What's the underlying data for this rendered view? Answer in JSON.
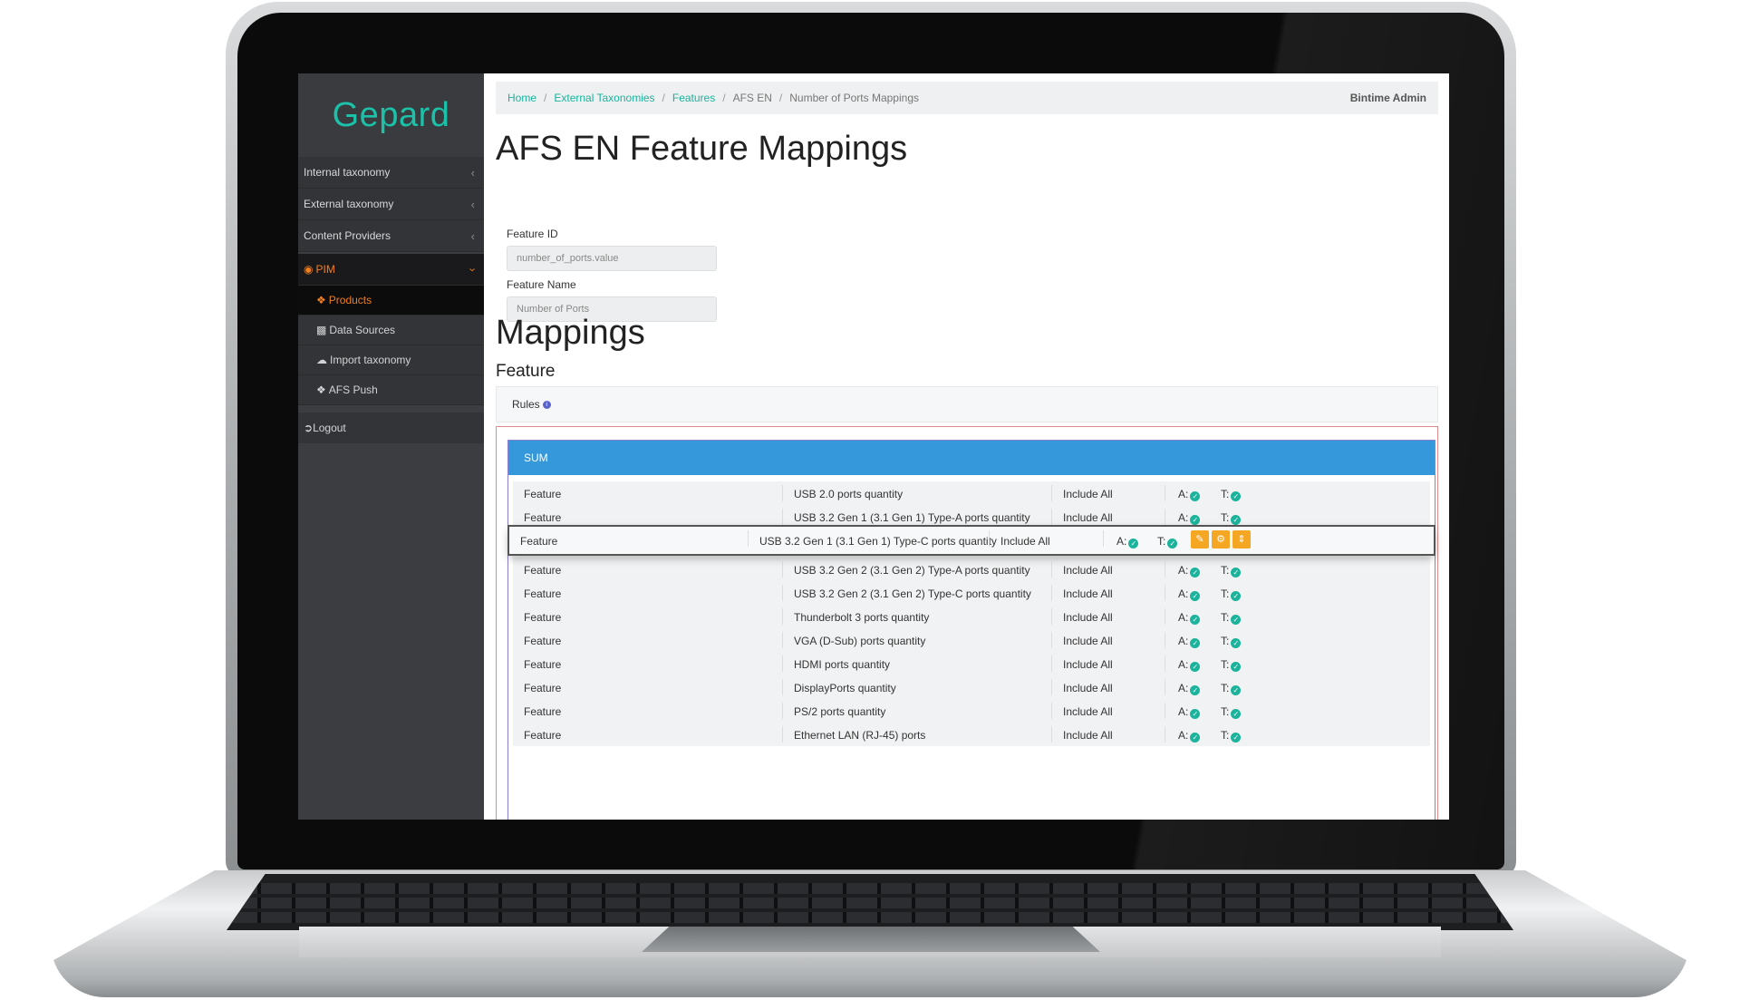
{
  "app": {
    "logo": "Gepard"
  },
  "sidebar": {
    "items": [
      {
        "label": "Internal taxonomy"
      },
      {
        "label": "External taxonomy"
      },
      {
        "label": "Content Providers"
      }
    ],
    "pim": {
      "label": "PIM",
      "sub_items": [
        {
          "label": "Products"
        },
        {
          "label": "Data Sources"
        },
        {
          "label": "Import taxonomy"
        },
        {
          "label": "AFS Push"
        }
      ]
    },
    "logout": "Logout"
  },
  "breadcrumb": [
    "Home",
    "External Taxonomies",
    "Features",
    "AFS EN",
    "Number of Ports Mappings"
  ],
  "user": "Bintime Admin",
  "page_title": "AFS EN Feature Mappings",
  "form": {
    "feature_id": {
      "label": "Feature ID",
      "value": "number_of_ports.value"
    },
    "feature_name": {
      "label": "Feature Name",
      "value": "Number of Ports"
    }
  },
  "mappings": {
    "title": "Mappings",
    "subtitle": "Feature",
    "rules_label": "Rules",
    "rules_info_glyph": "i",
    "group_title": "SUM",
    "a_label": "A:",
    "t_label": "T:",
    "rows": [
      {
        "type": "Feature",
        "name": "USB 2.0 ports quantity",
        "mode": "Include All"
      },
      {
        "type": "Feature",
        "name": "USB 3.2 Gen 1 (3.1 Gen 1) Type-A ports quantity",
        "mode": "Include All"
      },
      {
        "type": "Feature",
        "name": "USB 3.2 Gen 1 (3.1 Gen 1) Type-C ports quantity",
        "mode": "Include All"
      },
      {
        "type": "Feature",
        "name": "USB 3.2 Gen 2 (3.1 Gen 2) Type-A ports quantity",
        "mode": "Include All"
      },
      {
        "type": "Feature",
        "name": "USB 3.2 Gen 2 (3.1 Gen 2) Type-C ports quantity",
        "mode": "Include All"
      },
      {
        "type": "Feature",
        "name": "Thunderbolt 3 ports quantity",
        "mode": "Include All"
      },
      {
        "type": "Feature",
        "name": "VGA (D-Sub) ports quantity",
        "mode": "Include All"
      },
      {
        "type": "Feature",
        "name": "HDMI ports quantity",
        "mode": "Include All"
      },
      {
        "type": "Feature",
        "name": "DisplayPorts quantity",
        "mode": "Include All"
      },
      {
        "type": "Feature",
        "name": "PS/2 ports quantity",
        "mode": "Include All"
      },
      {
        "type": "Feature",
        "name": "Ethernet LAN (RJ-45) ports",
        "mode": "Include All"
      }
    ]
  },
  "icons": {
    "chevron": "chevron-left-icon",
    "check": "check-circle-icon",
    "edit": "edit-icon",
    "settings": "gear-icon",
    "sort": "sort-icon"
  },
  "colors": {
    "brand": "#1bc1a8",
    "accent_orange": "#f07f1f",
    "sum_header": "#3498db",
    "action_button": "#f5a623"
  }
}
